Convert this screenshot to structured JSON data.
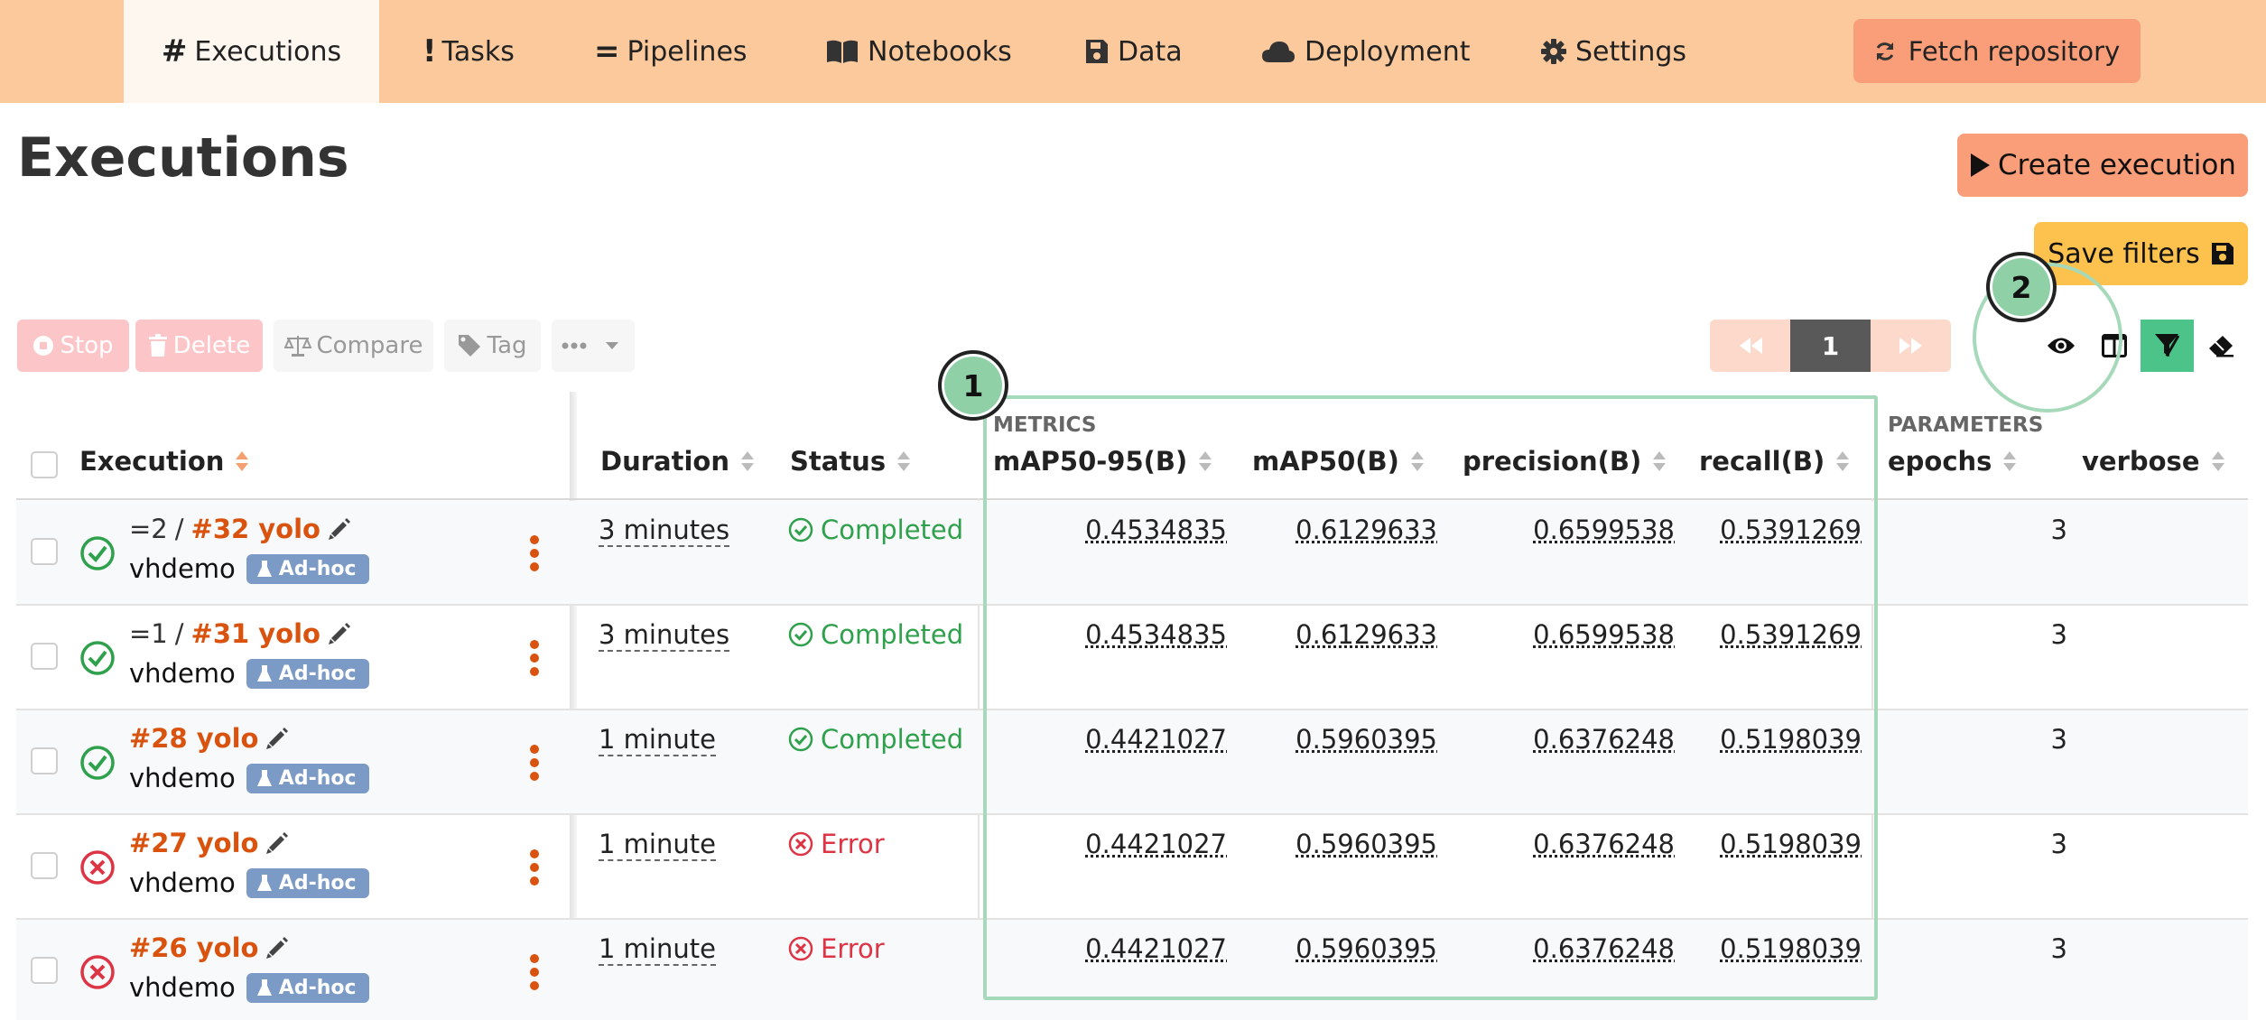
{
  "nav": {
    "tabs": [
      {
        "label": "Executions",
        "icon": "hash-icon"
      },
      {
        "label": "Tasks",
        "icon": "exclamation-icon"
      },
      {
        "label": "Pipelines",
        "icon": "equals-icon"
      },
      {
        "label": "Notebooks",
        "icon": "book-icon"
      },
      {
        "label": "Data",
        "icon": "floppy-disk-icon"
      },
      {
        "label": "Deployment",
        "icon": "cloud-icon"
      },
      {
        "label": "Settings",
        "icon": "gear-icon"
      }
    ],
    "active_tab": "Executions",
    "fetch_label": "Fetch repository"
  },
  "page": {
    "title": "Executions",
    "create_label": "Create execution",
    "save_filters_label": "Save filters"
  },
  "toolbar": {
    "stop": "Stop",
    "delete": "Delete",
    "compare": "Compare",
    "tag": "Tag"
  },
  "pager": {
    "current": "1"
  },
  "annotations": {
    "marker_1": "1",
    "marker_2": "2"
  },
  "table": {
    "groups": {
      "metrics": "METRICS",
      "parameters": "PARAMETERS"
    },
    "columns": {
      "execution": "Execution",
      "duration": "Duration",
      "status": "Status",
      "map50_95": "mAP50-95(B)",
      "map50": "mAP50(B)",
      "precision": "precision(B)",
      "recall": "recall(B)",
      "epochs": "epochs",
      "verbose": "verbose"
    },
    "rows": [
      {
        "prefix": "=2",
        "sep": "/",
        "name": "#32 yolo",
        "creator": "vhdemo",
        "badge": "Ad-hoc",
        "duration": "3 minutes",
        "status": "Completed",
        "status_kind": "ok",
        "map50_95": "0.4534835",
        "map50": "0.6129633",
        "precision": "0.6599538",
        "recall": "0.5391269",
        "epochs": "3",
        "verbose": ""
      },
      {
        "prefix": "=1",
        "sep": "/",
        "name": "#31 yolo",
        "creator": "vhdemo",
        "badge": "Ad-hoc",
        "duration": "3 minutes",
        "status": "Completed",
        "status_kind": "ok",
        "map50_95": "0.4534835",
        "map50": "0.6129633",
        "precision": "0.6599538",
        "recall": "0.5391269",
        "epochs": "3",
        "verbose": ""
      },
      {
        "prefix": "",
        "sep": "",
        "name": "#28 yolo",
        "creator": "vhdemo",
        "badge": "Ad-hoc",
        "duration": "1 minute",
        "status": "Completed",
        "status_kind": "ok",
        "map50_95": "0.4421027",
        "map50": "0.5960395",
        "precision": "0.6376248",
        "recall": "0.5198039",
        "epochs": "3",
        "verbose": ""
      },
      {
        "prefix": "",
        "sep": "",
        "name": "#27 yolo",
        "creator": "vhdemo",
        "badge": "Ad-hoc",
        "duration": "1 minute",
        "status": "Error",
        "status_kind": "err",
        "map50_95": "0.4421027",
        "map50": "0.5960395",
        "precision": "0.6376248",
        "recall": "0.5198039",
        "epochs": "3",
        "verbose": ""
      },
      {
        "prefix": "",
        "sep": "",
        "name": "#26 yolo",
        "creator": "vhdemo",
        "badge": "Ad-hoc",
        "duration": "1 minute",
        "status": "Error",
        "status_kind": "err",
        "map50_95": "0.4421027",
        "map50": "0.5960395",
        "precision": "0.6376248",
        "recall": "0.5198039",
        "epochs": "3",
        "verbose": ""
      }
    ]
  },
  "colors": {
    "nav_bg": "#fcc99c",
    "accent": "#f99e78",
    "link": "#d9530f",
    "success": "#2fa04b",
    "error": "#dc3545",
    "badge": "#7b9ac5",
    "highlight": "#a6d9b9"
  }
}
